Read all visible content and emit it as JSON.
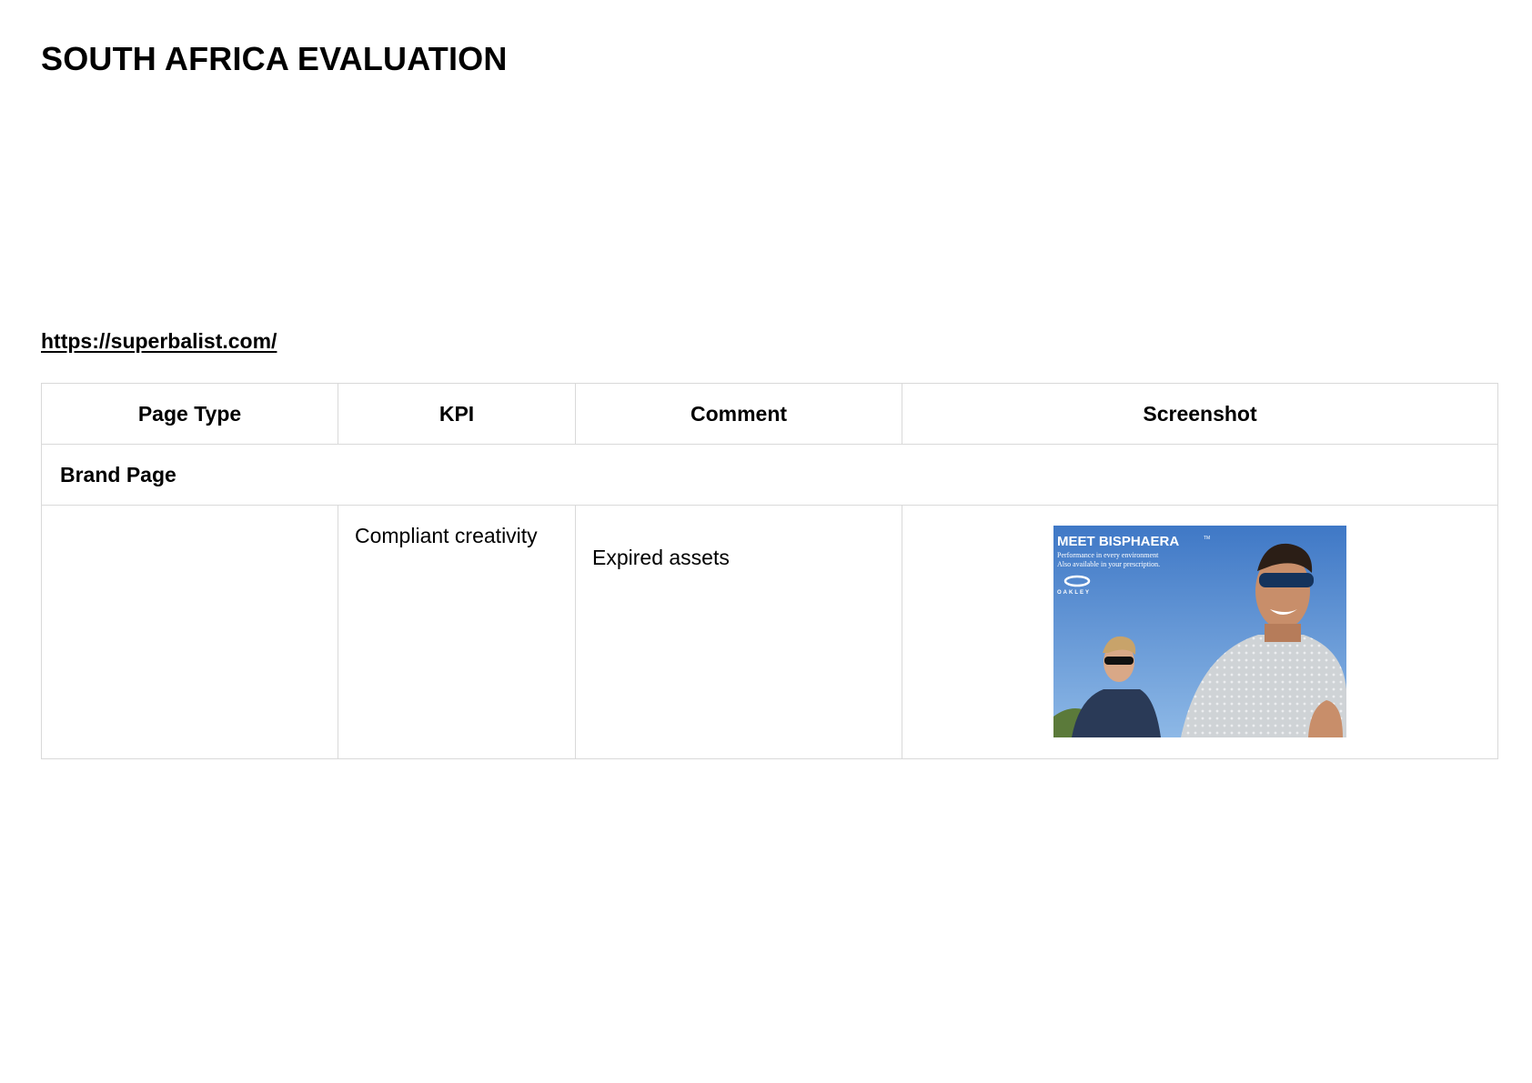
{
  "document": {
    "title": "SOUTH AFRICA EVALUATION",
    "url": "https://superbalist.com/"
  },
  "table": {
    "headers": [
      "Page Type",
      "KPI",
      "Comment",
      "Screenshot"
    ],
    "section": "Brand Page",
    "rows": [
      {
        "page_type": "",
        "kpi": "Compliant creativity",
        "comment": "Expired assets"
      }
    ]
  },
  "screenshot": {
    "headline": "MEET BISPHAERA",
    "trademark": "TM",
    "subline_1": "Performance in every environment",
    "subline_2": "Also available in your prescription.",
    "brand": "OAKLEY",
    "colors": {
      "sky_top": "#3f78c6",
      "sky_bottom": "#8db8e6",
      "shirt": "#cfd3d6",
      "text": "#ffffff"
    }
  }
}
